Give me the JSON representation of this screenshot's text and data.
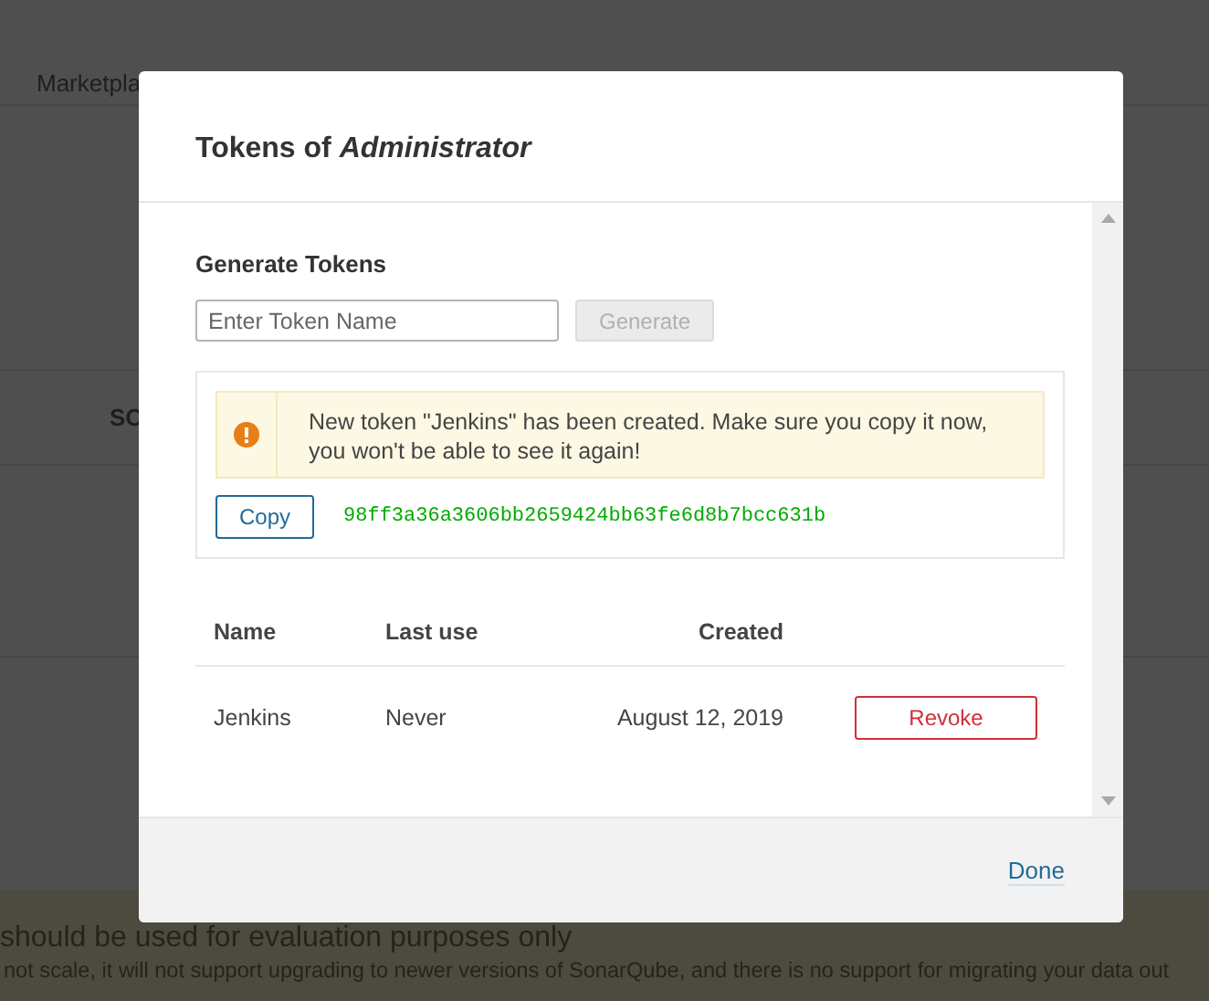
{
  "background": {
    "nav_text": "Marketpla",
    "section_text": "SC",
    "banner": {
      "title": "should be used for evaluation purposes only",
      "text": "not scale, it will not support upgrading to newer versions of SonarQube, and there is no support for migrating your data out"
    }
  },
  "modal": {
    "title": "Tokens of *Administrator*",
    "section_title": "Generate Tokens",
    "input": {
      "placeholder": "Enter Token Name"
    },
    "generate_button": {
      "label": "Generate",
      "disabled": true
    },
    "alert": {
      "text": "New token \"Jenkins\" has been created. Make sure you copy it now, you won't be able to see it again!"
    },
    "copy_button": "Copy",
    "token": "98ff3a36a3606bb2659424bb63fe6d8b7bcc631b",
    "table": {
      "columns": [
        "Name",
        "Last use",
        "Created"
      ],
      "rows": [
        {
          "name": "Jenkins",
          "last_use": "Never",
          "created": "August 12, 2019",
          "action": "Revoke"
        }
      ]
    },
    "footer": {
      "done": "Done"
    }
  }
}
